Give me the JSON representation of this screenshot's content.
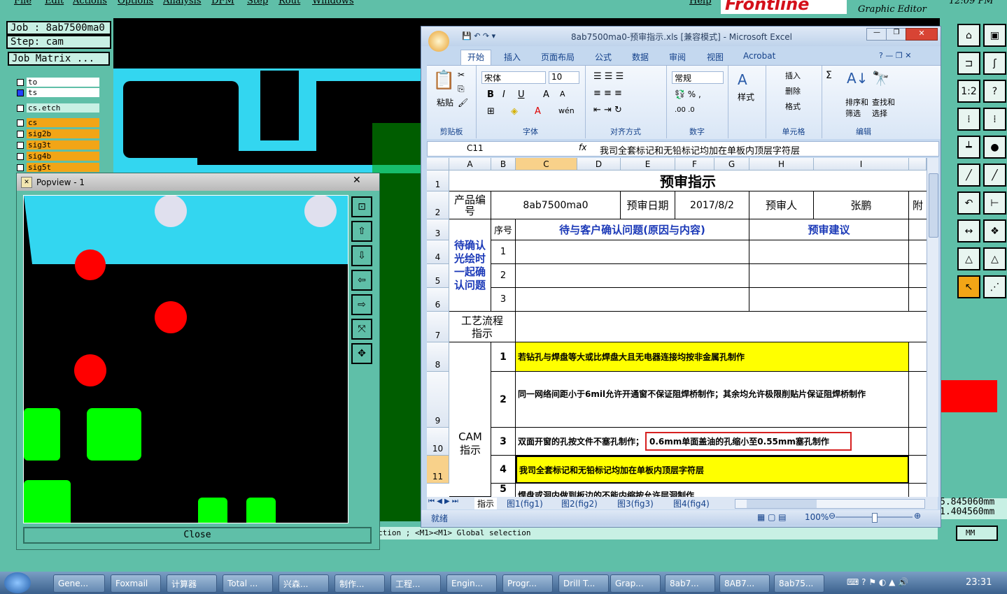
{
  "genesis": {
    "menu": [
      "File",
      "Edit",
      "Actions",
      "Options",
      "Analysis",
      "DFM",
      "Step",
      "Rout",
      "Windows",
      "Help"
    ],
    "job_label": "Job : 8ab7500ma0",
    "step_label": "Step: cam",
    "job_matrix": "Job Matrix ...",
    "layers": [
      "to",
      "ts",
      "cs.etch",
      "cs",
      "sig2b",
      "sig3t",
      "sig4b",
      "sig5t"
    ],
    "logo": "Frontline",
    "subtitle": "Graphic Editor",
    "clock": "12:09 PM",
    "status_text": "ction ; <M1><M1> Global selection",
    "coord_x": "5.845060mm",
    "coord_y": "1.404560mm",
    "units": "MM"
  },
  "popview": {
    "title": "Popview - 1",
    "close_label": "Close",
    "close_x": "✕"
  },
  "excel": {
    "title": "8ab7500ma0-预审指示.xls  [兼容模式] - Microsoft Excel",
    "tabs": [
      "开始",
      "插入",
      "页面布局",
      "公式",
      "数据",
      "审阅",
      "视图",
      "Acrobat"
    ],
    "groups": {
      "clipboard": "剪贴板",
      "paste": "粘贴",
      "font": "字体",
      "font_name": "宋体",
      "font_size": "10",
      "align": "对齐方式",
      "number": "数字",
      "number_format": "常规",
      "styles": "样式",
      "cells": "单元格",
      "insert": "插入",
      "delete": "删除",
      "format": "格式",
      "editing": "编辑",
      "sort": "排序和筛选",
      "find": "查找和选择"
    },
    "name_box": "C11",
    "fx": "fx",
    "formula": "我司全套标记和无铅标记均加在单板内顶层字符层",
    "columns": [
      "A",
      "B",
      "C",
      "D",
      "E",
      "F",
      "G",
      "H",
      "I"
    ],
    "rows": [
      "1",
      "2",
      "3",
      "4",
      "5",
      "6",
      "7",
      "8",
      "9",
      "10",
      "11"
    ],
    "cells": {
      "title": "预审指示",
      "product_no_label": "产品编号",
      "product_no": "8ab7500ma0",
      "review_date_label": "预审日期",
      "review_date": "2017/8/2",
      "reviewer_label": "预审人",
      "reviewer": "张鹏",
      "attach": "附",
      "seq_label": "序号",
      "confirm_header": "待与客户确认问题(原因与内容)",
      "suggest_header": "预审建议",
      "confirm_label": "待确认光绘时一起确认问题",
      "seq1": "1",
      "seq2": "2",
      "seq3": "3",
      "process_label": "工艺流程指示",
      "cam_label": "CAM指示",
      "cam1_no": "1",
      "cam1": "若钻孔与焊盘等大或比焊盘大且无电器连接均按非金属孔制作",
      "cam2_no": "2",
      "cam2": "同一网络间距小于6mil允许开通窗不保证阻焊桥制作；其余均允许极限削贴片保证阻焊桥制作",
      "cam3_no": "3",
      "cam3a": "双面开窗的孔按文件不塞孔制作；",
      "cam3b": "0.6mm单面盖油的孔缩小至0.55mm塞孔制作",
      "cam4_no": "4",
      "cam4": "我司全套标记和无铅标记均加在单板内顶层字符层",
      "cam5_no": "5",
      "cam5": "焊盘或洞内做到板边的不能内缩按允许层洞制作"
    },
    "sheet_tabs": [
      "指示",
      "图1(fig1)",
      "图2(fig2)",
      "图3(fig3)",
      "图4(fig4)"
    ],
    "status": "就绪",
    "zoom": "100%"
  },
  "taskbar": {
    "items": [
      "Gene...",
      "Foxmail",
      "计算器",
      "Total ...",
      "兴森...",
      "制作...",
      "工程...",
      "Engin...",
      "Progr...",
      "Drill T...",
      "Grap...",
      "8ab7...",
      "8AB7...",
      "8ab75..."
    ],
    "time": "23:31"
  },
  "colors": {
    "genesis_teal": "#5fbfa8",
    "pad_red": "#ff0000",
    "pad_green": "#00ff00",
    "copper_cyan": "#33d6f0",
    "excel_yellow": "#ffff00"
  }
}
